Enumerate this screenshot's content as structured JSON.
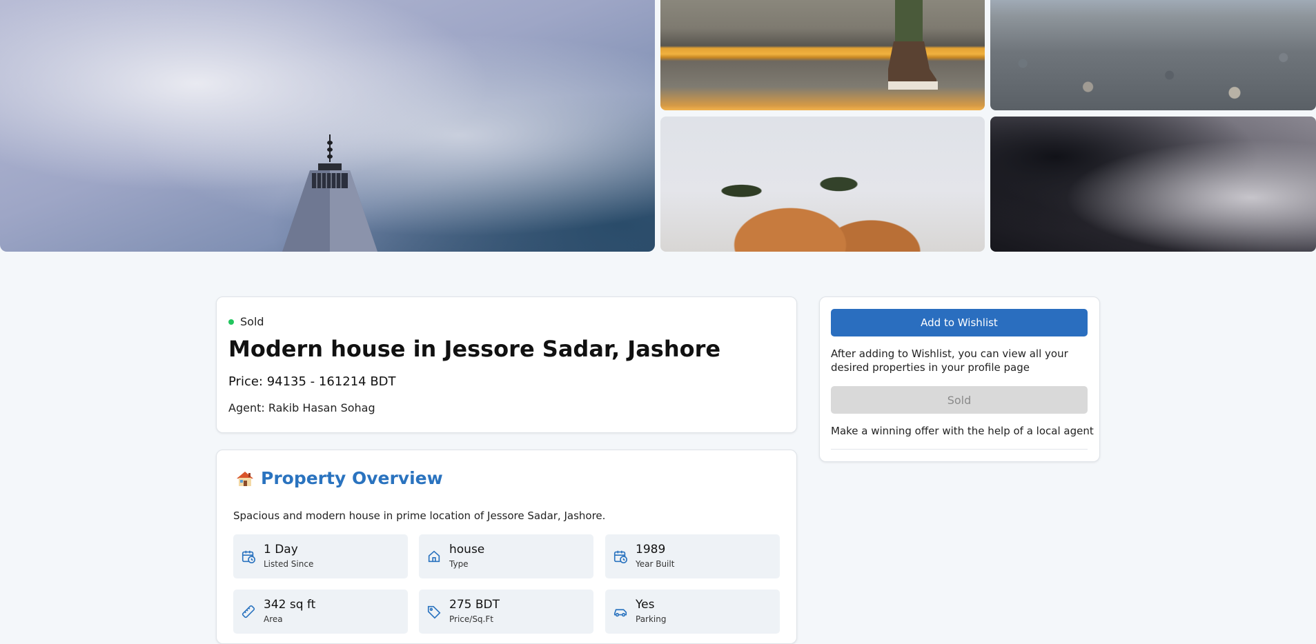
{
  "listing": {
    "status": "Sold",
    "title": "Modern house in Jessore Sadar, Jashore",
    "price": "Price: 94135 - 161214 BDT",
    "agent": "Agent: Rakib Hasan Sohag"
  },
  "overview": {
    "heading": "Property Overview",
    "icon": "house-icon",
    "description": "Spacious and modern house in prime location of Jessore Sadar, Jashore.",
    "stats": [
      {
        "value": "1 Day",
        "label": "Listed Since",
        "icon": "calendar-clock-icon"
      },
      {
        "value": "house",
        "label": "Type",
        "icon": "home-icon"
      },
      {
        "value": "1989",
        "label": "Year Built",
        "icon": "calendar-clock-icon"
      },
      {
        "value": "342 sq ft",
        "label": "Area",
        "icon": "ruler-icon"
      },
      {
        "value": "275 BDT",
        "label": "Price/Sq.Ft",
        "icon": "tag-icon"
      },
      {
        "value": "Yes",
        "label": "Parking",
        "icon": "car-icon"
      }
    ]
  },
  "sidebar": {
    "wishlist_button": "Add to Wishlist",
    "wishlist_note": "After adding to Wishlist, you can view all your desired properties in your profile page",
    "sold_button": "Sold",
    "offer_note": "Make a winning offer with the help of a local agent"
  },
  "colors": {
    "accent": "#2a73bf",
    "status_dot": "#22c55e",
    "page_bg": "#f4f7fa"
  }
}
